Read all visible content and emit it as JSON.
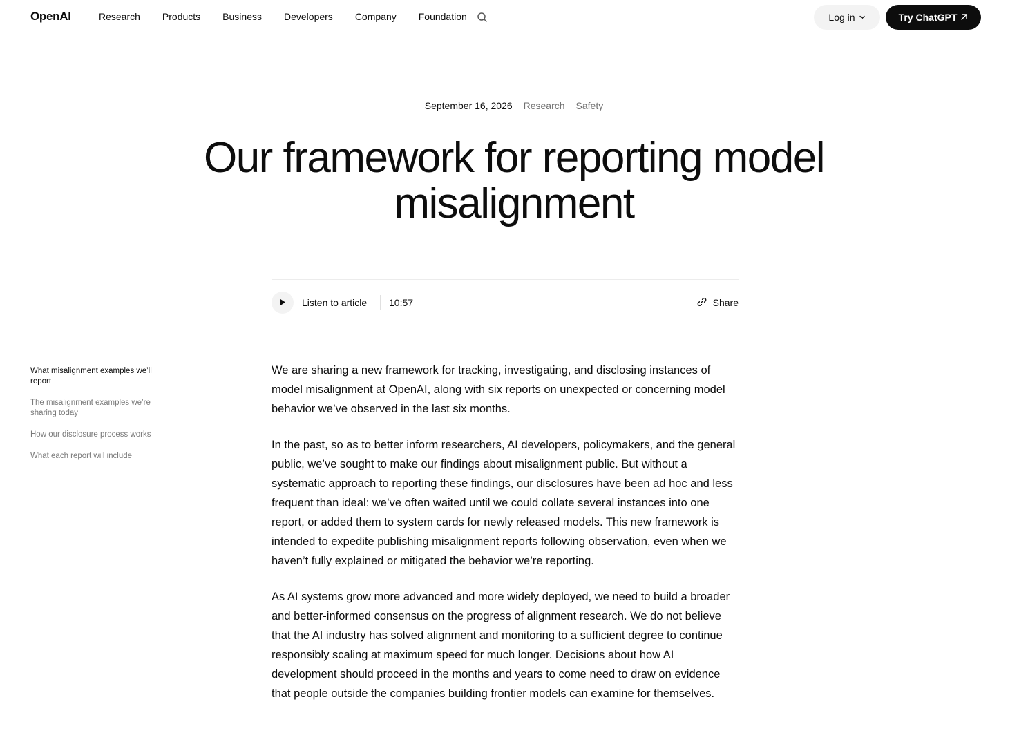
{
  "nav": {
    "logo": "OpenAI",
    "links": [
      "Research",
      "Products",
      "Business",
      "Developers",
      "Company",
      "Foundation"
    ],
    "search_icon": "search-icon",
    "login_label": "Log in",
    "try_label": "Try ChatGPT",
    "try_icon": "arrow-up-right-icon"
  },
  "article": {
    "date": "September 16, 2026",
    "tags": [
      "Research",
      "Safety"
    ],
    "title": "Our framework for reporting model misalignment",
    "audio": {
      "listen_label": "Listen to article",
      "duration": "10:57",
      "play_icon": "play-icon"
    },
    "share_label": "Share",
    "share_icon": "link-icon"
  },
  "toc": {
    "items": [
      "What misalignment examples we’ll report",
      "The misalignment examples we’re sharing today",
      "How our disclosure process works",
      "What each report will include"
    ],
    "active_index": 0
  },
  "body": {
    "p1": "We are sharing a new framework for tracking, investigating, and disclosing instances of model misalignment at OpenAI, along with six reports on unexpected or concerning model behavior we’ve observed in the last six months.",
    "p2": {
      "before": "In the past, so as to better inform researchers, AI developers, policymakers, and the general public, we’ve sought to make ",
      "link1": "our",
      "link2": "findings",
      "link3": "about",
      "link4": "misalignment",
      "after": " public. But without a systematic approach to reporting these findings, our disclosures have been ad hoc and less frequent than ideal: we’ve often waited until we could collate several instances into one report, or added them to system cards for newly released models. This new framework is intended to expedite publishing misalignment reports following observation, even when we haven’t fully explained or mitigated the behavior we’re reporting."
    },
    "p3": {
      "before": "As AI systems grow more advanced and more widely deployed, we need to build a broader and better-informed consensus on the progress of alignment research. We ",
      "link": "do not believe",
      "after": " that the AI industry has solved alignment and monitoring to a sufficient degree to continue responsibly scaling at maximum speed for much longer. Decisions about how AI development should proceed in the months and years to come need to draw on evidence that people outside the companies building frontier models can examine for themselves."
    }
  }
}
